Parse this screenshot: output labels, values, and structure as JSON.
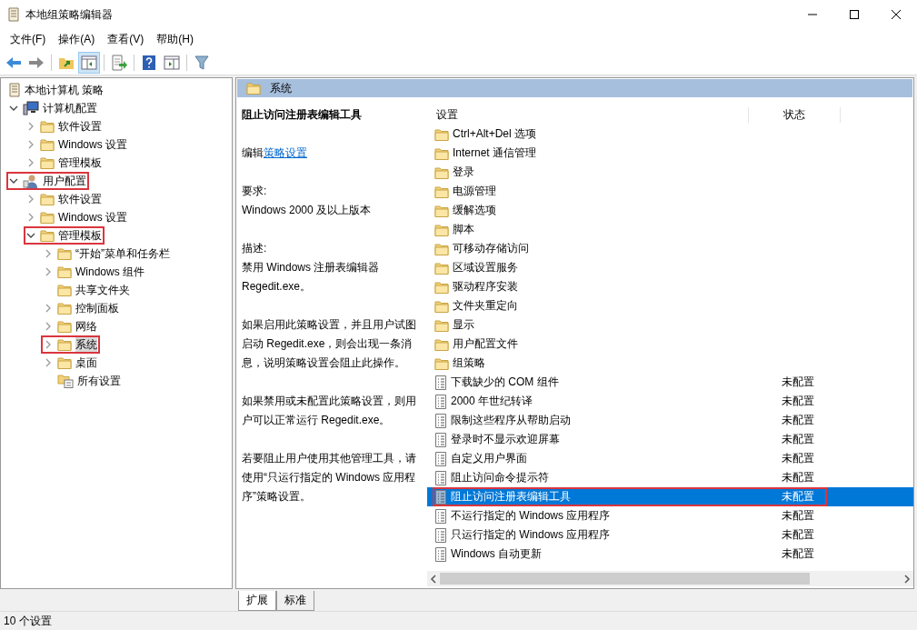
{
  "window": {
    "title": "本地组策略编辑器"
  },
  "menu": [
    "文件(F)",
    "操作(A)",
    "查看(V)",
    "帮助(H)"
  ],
  "toolbar": [
    {
      "kind": "back",
      "pressed": false
    },
    {
      "kind": "forward",
      "pressed": false
    },
    {
      "kind": "separator"
    },
    {
      "kind": "up",
      "pressed": false
    },
    {
      "kind": "tree",
      "pressed": true
    },
    {
      "kind": "separator"
    },
    {
      "kind": "export",
      "pressed": false
    },
    {
      "kind": "separator"
    },
    {
      "kind": "help",
      "pressed": false
    },
    {
      "kind": "pane",
      "pressed": false
    },
    {
      "kind": "separator"
    },
    {
      "kind": "filter",
      "pressed": false
    }
  ],
  "tree": [
    {
      "label": "本地计算机 策略",
      "kind": "policy",
      "selected": false,
      "highlighted": false,
      "children": [
        {
          "label": "计算机配置",
          "kind": "computer",
          "expanded": true,
          "selected": false,
          "highlighted": false,
          "children": [
            {
              "label": "软件设置",
              "kind": "folder",
              "expanded": false,
              "selected": false,
              "highlighted": false
            },
            {
              "label": "Windows 设置",
              "kind": "folder",
              "expanded": false,
              "selected": false,
              "highlighted": false
            },
            {
              "label": "管理模板",
              "kind": "folder",
              "expanded": false,
              "selected": false,
              "highlighted": false
            }
          ]
        },
        {
          "label": "用户配置",
          "kind": "user",
          "expanded": true,
          "selected": false,
          "highlighted": true,
          "children": [
            {
              "label": "软件设置",
              "kind": "folder",
              "expanded": false,
              "selected": false,
              "highlighted": false
            },
            {
              "label": "Windows 设置",
              "kind": "folder",
              "expanded": false,
              "selected": false,
              "highlighted": false
            },
            {
              "label": "管理模板",
              "kind": "folder",
              "expanded": true,
              "selected": false,
              "highlighted": true,
              "children": [
                {
                  "label": "“开始”菜单和任务栏",
                  "kind": "folder",
                  "expanded": false,
                  "selected": false,
                  "highlighted": false
                },
                {
                  "label": "Windows 组件",
                  "kind": "folder",
                  "expanded": false,
                  "selected": false,
                  "highlighted": false
                },
                {
                  "label": "共享文件夹",
                  "kind": "folder",
                  "selected": false,
                  "highlighted": false
                },
                {
                  "label": "控制面板",
                  "kind": "folder",
                  "expanded": false,
                  "selected": false,
                  "highlighted": false
                },
                {
                  "label": "网络",
                  "kind": "folder",
                  "expanded": false,
                  "selected": false,
                  "highlighted": false
                },
                {
                  "label": "系统",
                  "kind": "folder",
                  "expanded": false,
                  "selected": true,
                  "highlighted": true
                },
                {
                  "label": "桌面",
                  "kind": "folder",
                  "expanded": false,
                  "selected": false,
                  "highlighted": false
                },
                {
                  "label": "所有设置",
                  "kind": "all",
                  "selected": false,
                  "highlighted": false
                }
              ]
            }
          ]
        }
      ]
    }
  ],
  "header": {
    "title": "系统"
  },
  "description": {
    "title": "阻止访问注册表编辑工具",
    "edit_prefix": "编辑",
    "edit_link": "策略设置",
    "requirements_label": "要求:",
    "requirements": "Windows 2000 及以上版本",
    "description_label": "描述:",
    "paragraphs": [
      "禁用 Windows 注册表编辑器 Regedit.exe。",
      "如果启用此策略设置，并且用户试图启动 Regedit.exe，则会出现一条消息，说明策略设置会阻止此操作。",
      "如果禁用或未配置此策略设置，则用户可以正常运行 Regedit.exe。",
      "若要阻止用户使用其他管理工具，请使用“只运行指定的 Windows 应用程序”策略设置。"
    ]
  },
  "table": {
    "columns": [
      "设置",
      "状态"
    ],
    "rows": [
      {
        "kind": "folder",
        "name": "Ctrl+Alt+Del 选项",
        "selected": false,
        "highlighted": false
      },
      {
        "kind": "folder",
        "name": "Internet 通信管理",
        "selected": false,
        "highlighted": false
      },
      {
        "kind": "folder",
        "name": "登录",
        "selected": false,
        "highlighted": false
      },
      {
        "kind": "folder",
        "name": "电源管理",
        "selected": false,
        "highlighted": false
      },
      {
        "kind": "folder",
        "name": "缓解选项",
        "selected": false,
        "highlighted": false
      },
      {
        "kind": "folder",
        "name": "脚本",
        "selected": false,
        "highlighted": false
      },
      {
        "kind": "folder",
        "name": "可移动存储访问",
        "selected": false,
        "highlighted": false
      },
      {
        "kind": "folder",
        "name": "区域设置服务",
        "selected": false,
        "highlighted": false
      },
      {
        "kind": "folder",
        "name": "驱动程序安装",
        "selected": false,
        "highlighted": false
      },
      {
        "kind": "folder",
        "name": "文件夹重定向",
        "selected": false,
        "highlighted": false
      },
      {
        "kind": "folder",
        "name": "显示",
        "selected": false,
        "highlighted": false
      },
      {
        "kind": "folder",
        "name": "用户配置文件",
        "selected": false,
        "highlighted": false
      },
      {
        "kind": "folder",
        "name": "组策略",
        "selected": false,
        "highlighted": false
      },
      {
        "kind": "policy",
        "name": "下载缺少的 COM 组件",
        "state": "未配置",
        "selected": false,
        "highlighted": false
      },
      {
        "kind": "policy",
        "name": "2000 年世纪转译",
        "state": "未配置",
        "selected": false,
        "highlighted": false
      },
      {
        "kind": "policy",
        "name": "限制这些程序从帮助启动",
        "state": "未配置",
        "selected": false,
        "highlighted": false
      },
      {
        "kind": "policy",
        "name": "登录时不显示欢迎屏幕",
        "state": "未配置",
        "selected": false,
        "highlighted": false
      },
      {
        "kind": "policy",
        "name": "自定义用户界面",
        "state": "未配置",
        "selected": false,
        "highlighted": false
      },
      {
        "kind": "policy",
        "name": "阻止访问命令提示符",
        "state": "未配置",
        "selected": false,
        "highlighted": false
      },
      {
        "kind": "policy",
        "name": "阻止访问注册表编辑工具",
        "state": "未配置",
        "selected": true,
        "highlighted": true
      },
      {
        "kind": "policy",
        "name": "不运行指定的 Windows 应用程序",
        "state": "未配置",
        "selected": false,
        "highlighted": false
      },
      {
        "kind": "policy",
        "name": "只运行指定的 Windows 应用程序",
        "state": "未配置",
        "selected": false,
        "highlighted": false
      },
      {
        "kind": "policy",
        "name": "Windows 自动更新",
        "state": "未配置",
        "selected": false,
        "highlighted": false
      }
    ]
  },
  "tabs": [
    {
      "label": "扩展",
      "selected": true
    },
    {
      "label": "标准",
      "selected": false
    }
  ],
  "status_bar": "10 个设置"
}
